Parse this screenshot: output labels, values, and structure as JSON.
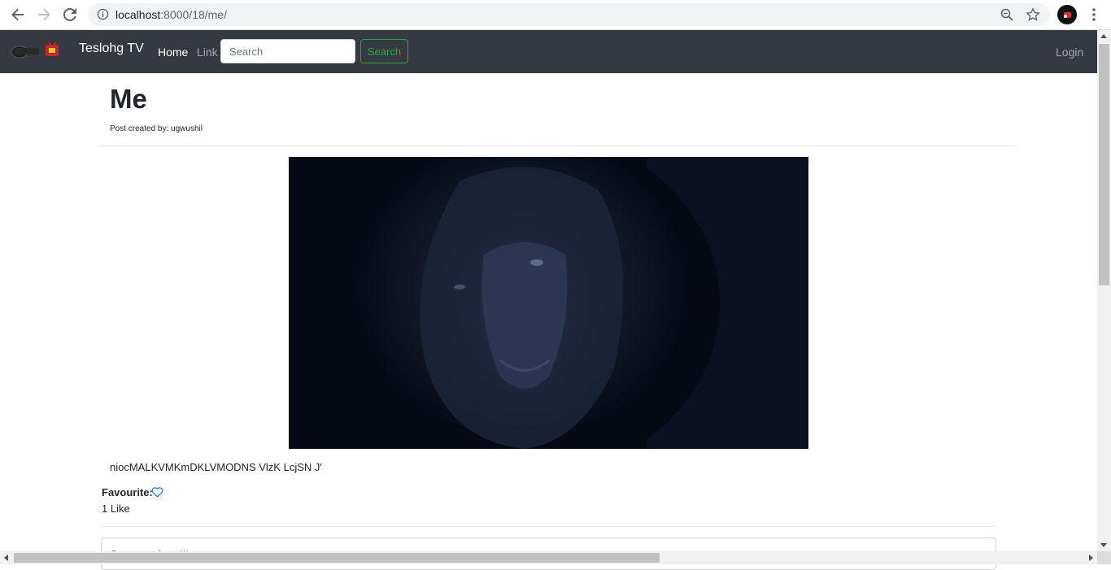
{
  "browser": {
    "url_host": "localhost",
    "url_rest": ":8000/18/me/"
  },
  "navbar": {
    "brand": "Teslohg TV",
    "links": [
      "Home",
      "Link"
    ],
    "search_placeholder": "Search",
    "search_button": "Search",
    "login": "Login"
  },
  "post": {
    "title": "Me",
    "meta": "Post created by: ugwushil",
    "body": "niocMALKVMKmDKLVMODNS VlzK LcjSN J'",
    "favourite_label": "Favourite:",
    "likes": "1 Like",
    "comment_placeholder": "Comment here!!!"
  },
  "colors": {
    "navbar_bg": "#343a40",
    "success": "#28a745",
    "heart": "#007bff"
  }
}
